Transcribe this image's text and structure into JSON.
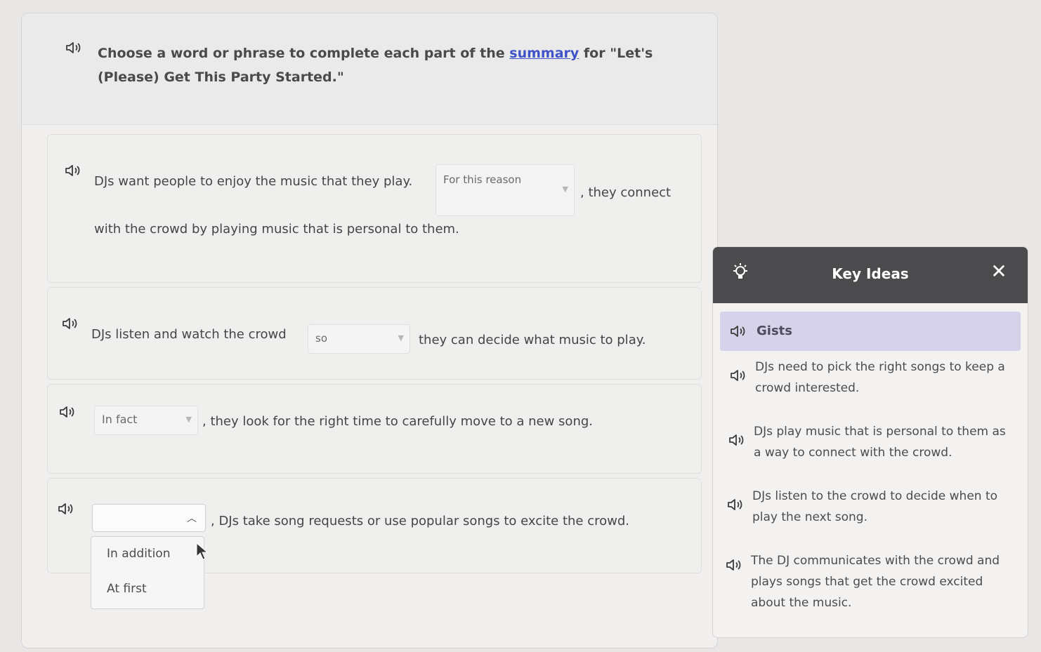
{
  "prompt": {
    "text_before": "Choose a word or phrase to complete each part of the ",
    "link": "summary",
    "text_after": " for \"Let's (Please) Get This Party Started.\""
  },
  "items": [
    {
      "before": "DJs want people to enjoy the music that they play.",
      "selected": "For this reason",
      "after": ", they connect",
      "line2": "with the crowd by playing music that is personal to them."
    },
    {
      "before": "DJs listen and watch the crowd",
      "selected": "so",
      "after": "they can decide what music to play."
    },
    {
      "selected": "In fact",
      "after": ", they look for the right time to carefully move to a new song."
    },
    {
      "selected": "",
      "after": ", DJs take song requests or use popular songs to excite the crowd."
    }
  ],
  "dropdown_options": [
    "In addition",
    "At first"
  ],
  "key_ideas": {
    "title": "Key Ideas",
    "close_glyph": "✕",
    "section": "Gists",
    "ideas": [
      "DJs need to pick the right songs to keep a crowd interested.",
      "DJs play music that is personal to them as a way to connect with the crowd.",
      "DJs listen to the crowd to decide when to play the next song.",
      "The DJ communicates with the crowd and plays songs that get the crowd excited about the music."
    ]
  },
  "icons": {
    "speaker": "speaker-icon",
    "bulb": "lightbulb-icon",
    "chevron": "chevron-down-icon",
    "chevron_open": "chevron-up-icon"
  },
  "colors": {
    "link": "#3f52c8",
    "panel_header": "#4b4b4d",
    "gists_bar": "#d5d2e9"
  }
}
